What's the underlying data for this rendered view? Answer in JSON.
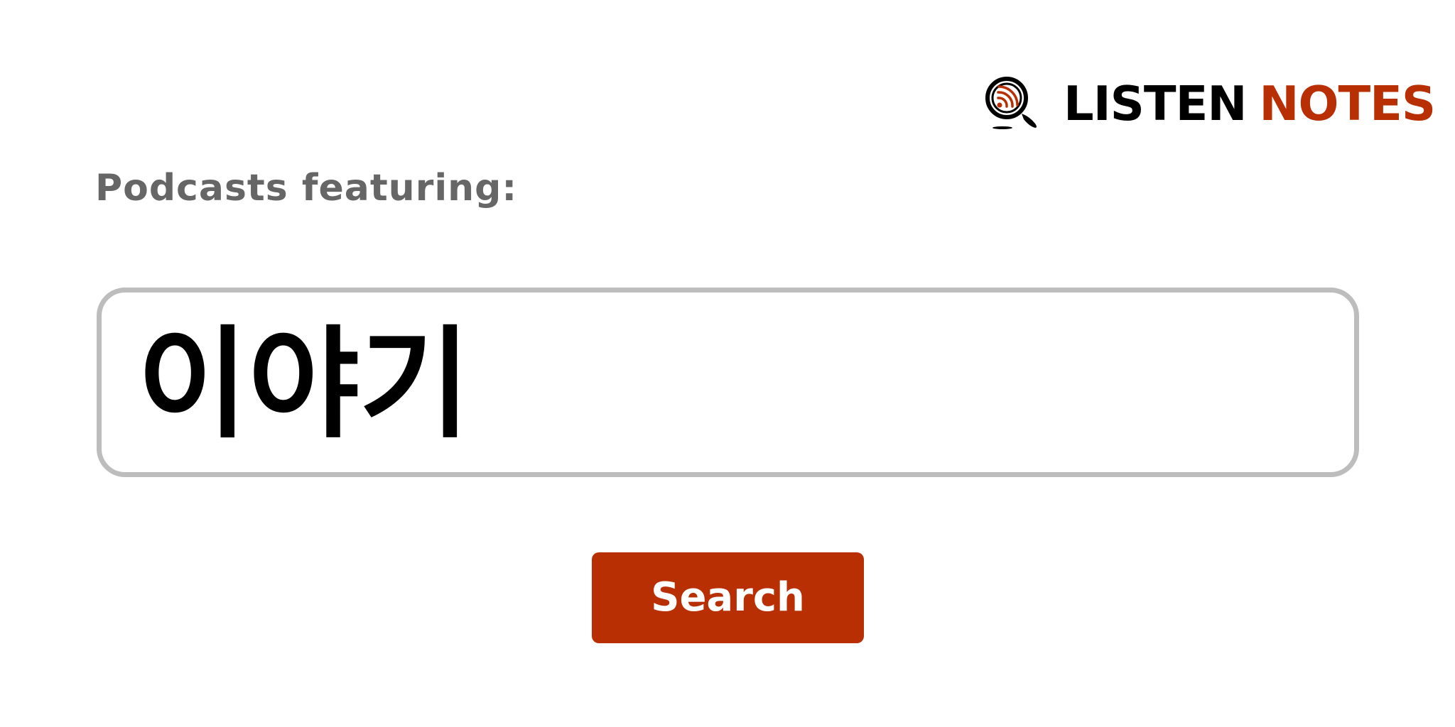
{
  "logo": {
    "icon": "podcast-search-magnifier-icon",
    "word1": "LISTEN",
    "word2": "NOTES",
    "word1_color": "#000000",
    "word2_color": "#b92f04"
  },
  "heading": "Podcasts featuring:",
  "search": {
    "value": "이야기"
  },
  "button": {
    "label": "Search",
    "color": "#b92f04"
  }
}
